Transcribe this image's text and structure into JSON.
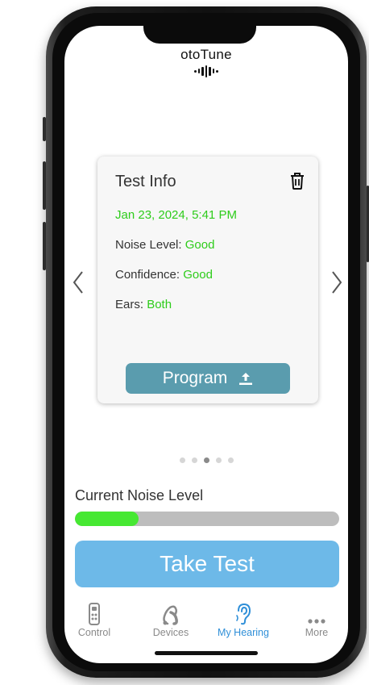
{
  "app": {
    "name": "otoTune"
  },
  "card": {
    "title": "Test Info",
    "date": "Jan 23, 2024, 5:41 PM",
    "noise_label": "Noise Level:",
    "noise_value": "Good",
    "confidence_label": "Confidence:",
    "confidence_value": "Good",
    "ears_label": "Ears:",
    "ears_value": "Both",
    "program_label": "Program"
  },
  "pagination": {
    "count": 5,
    "active_index": 2
  },
  "noise_meter": {
    "label": "Current Noise Level",
    "level_fraction": 0.24
  },
  "take_test": {
    "label": "Take Test"
  },
  "tabs": [
    {
      "label": "Control",
      "icon": "hearing-aid-remote-icon",
      "active": false
    },
    {
      "label": "Devices",
      "icon": "hearing-aid-device-icon",
      "active": false
    },
    {
      "label": "My Hearing",
      "icon": "ear-icon",
      "active": true
    },
    {
      "label": "More",
      "icon": "more-dots-icon",
      "active": false
    }
  ],
  "colors": {
    "accent_blue": "#6db9e8",
    "program_button": "#5a9cae",
    "good_green": "#2ecc1b",
    "noise_fill": "#46e832",
    "active_tab": "#2f8fd8"
  }
}
